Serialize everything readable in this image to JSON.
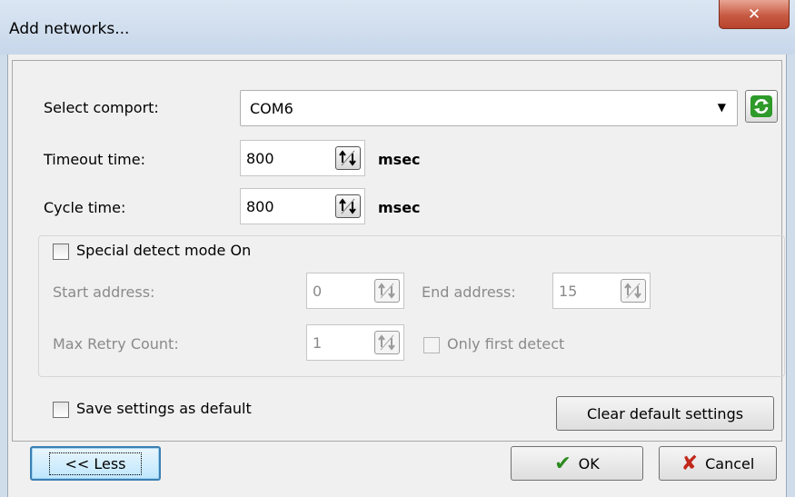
{
  "window": {
    "title": "Add networks...",
    "close_icon": "close-icon"
  },
  "comport": {
    "label": "Select comport:",
    "value": "COM6"
  },
  "timeout": {
    "label": "Timeout time:",
    "value": "800",
    "unit": "msec"
  },
  "cycle": {
    "label": "Cycle time:",
    "value": "800",
    "unit": "msec"
  },
  "special": {
    "checkbox_label": "Special detect mode On",
    "start_label": "Start address:",
    "start_value": "0",
    "end_label": "End address:",
    "end_value": "15",
    "retry_label": "Max Retry Count:",
    "retry_value": "1",
    "only_first_label": "Only first detect"
  },
  "save_default_label": "Save settings as default",
  "clear_default_label": "Clear default settings",
  "buttons": {
    "less": "<< Less",
    "ok": "OK",
    "cancel": "Cancel"
  },
  "colors": {
    "ok_check": "#2b8a1e",
    "cancel_x": "#c2281a",
    "refresh": "#2e9a2a",
    "close_btn": "#c75a43"
  }
}
